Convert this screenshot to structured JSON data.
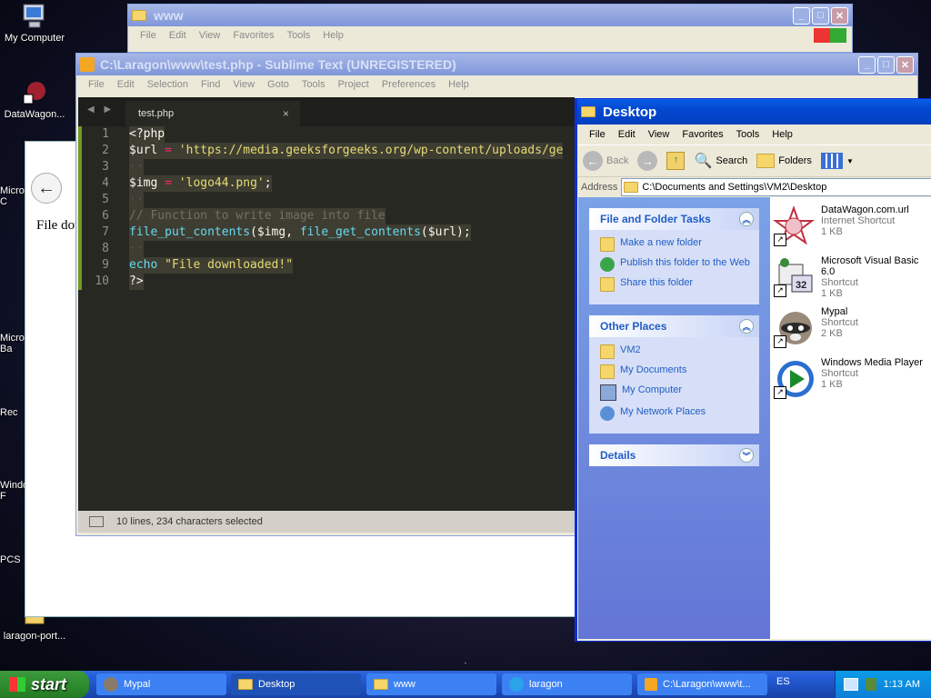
{
  "desktop_icons": [
    {
      "label": "My Computer"
    },
    {
      "label": "DataWagon..."
    },
    {
      "label": "Micro\nC"
    },
    {
      "label": "Micro\nBa"
    },
    {
      "label": "Rec"
    },
    {
      "label": "Windo\nF"
    },
    {
      "label": "PCS"
    },
    {
      "label": "laragon-port..."
    }
  ],
  "www_window": {
    "title": "www",
    "menu": [
      "File",
      "Edit",
      "View",
      "Favorites",
      "Tools",
      "Help"
    ]
  },
  "bg_browser": {
    "page_text": "File dov"
  },
  "sublime": {
    "title": "C:\\Laragon\\www\\test.php - Sublime Text (UNREGISTERED)",
    "menu": [
      "File",
      "Edit",
      "Selection",
      "Find",
      "View",
      "Goto",
      "Tools",
      "Project",
      "Preferences",
      "Help"
    ],
    "tab_label": "test.php",
    "tab_close": "×",
    "status": "10 lines, 234 characters selected",
    "lines": [
      {
        "n": "1",
        "parts": [
          {
            "t": "<?php",
            "c": "k-wht"
          }
        ]
      },
      {
        "n": "2",
        "parts": [
          {
            "t": "$url",
            "c": "k-wht"
          },
          {
            "t": " = ",
            "c": "k-pink"
          },
          {
            "t": "'https://media.geeksforgeeks.org/wp-content/uploads/ge",
            "c": "k-yel"
          }
        ]
      },
      {
        "n": "3",
        "parts": [
          {
            "t": "··",
            "c": "dots"
          }
        ]
      },
      {
        "n": "4",
        "parts": [
          {
            "t": "$img",
            "c": "k-wht"
          },
          {
            "t": " = ",
            "c": "k-pink"
          },
          {
            "t": "'logo44.png'",
            "c": "k-yel"
          },
          {
            "t": ";",
            "c": "k-wht"
          }
        ]
      },
      {
        "n": "5",
        "parts": [
          {
            "t": "··",
            "c": "dots"
          }
        ]
      },
      {
        "n": "6",
        "parts": [
          {
            "t": "// Function to write image into file",
            "c": "k-com"
          }
        ]
      },
      {
        "n": "7",
        "parts": [
          {
            "t": "file_put_contents",
            "c": "k-cyan"
          },
          {
            "t": "($img, ",
            "c": "k-wht"
          },
          {
            "t": "file_get_contents",
            "c": "k-cyan"
          },
          {
            "t": "($url);",
            "c": "k-wht"
          }
        ]
      },
      {
        "n": "8",
        "parts": [
          {
            "t": "··",
            "c": "dots"
          }
        ]
      },
      {
        "n": "9",
        "parts": [
          {
            "t": "echo",
            "c": "k-cyan"
          },
          {
            "t": " ",
            "c": "k-wht"
          },
          {
            "t": "\"File downloaded!\"",
            "c": "k-yel"
          }
        ]
      },
      {
        "n": "10",
        "parts": [
          {
            "t": "?>",
            "c": "k-wht"
          }
        ]
      }
    ]
  },
  "explorer": {
    "title": "Desktop",
    "menu": [
      "File",
      "Edit",
      "View",
      "Favorites",
      "Tools",
      "Help"
    ],
    "toolbar": {
      "back": "Back",
      "search": "Search",
      "folders": "Folders"
    },
    "address_label": "Address",
    "address_value": "C:\\Documents and Settings\\VM2\\Desktop",
    "tasks_title": "File and Folder Tasks",
    "tasks": [
      "Make a new folder",
      "Publish this folder to the Web",
      "Share this folder"
    ],
    "places_title": "Other Places",
    "places": [
      "VM2",
      "My Documents",
      "My Computer",
      "My Network Places"
    ],
    "details_title": "Details",
    "files": [
      {
        "name": "DataWagon.com.url",
        "type": "Internet Shortcut",
        "size": "1 KB"
      },
      {
        "name": "Microsoft Visual Basic 6.0",
        "type": "Shortcut",
        "size": "1 KB"
      },
      {
        "name": "Mypal",
        "type": "Shortcut",
        "size": "2 KB"
      },
      {
        "name": "Windows Media Player",
        "type": "Shortcut",
        "size": "1 KB"
      }
    ]
  },
  "taskbar": {
    "start": "start",
    "tasks": [
      "Mypal",
      "Desktop",
      "www",
      "laragon",
      "C:\\Laragon\\www\\t..."
    ],
    "lang": "ES",
    "clock": "1:13 AM"
  }
}
